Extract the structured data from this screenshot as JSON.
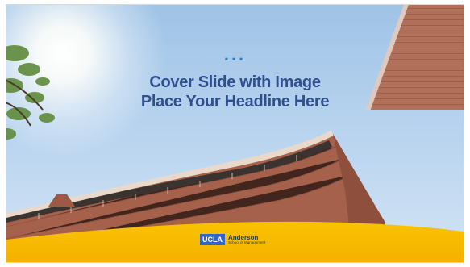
{
  "slide": {
    "dots": "...",
    "title_line1": "Cover Slide with Image",
    "title_line2": "Place Your Headline Here"
  },
  "logo": {
    "badge": "UCLA",
    "name": "Anderson",
    "subtitle": "School of Management"
  },
  "colors": {
    "title": "#2f4f8e",
    "dots": "#2f7fc1",
    "footer_yellow": "#f5b800",
    "ucla_blue": "#2d68c4"
  }
}
